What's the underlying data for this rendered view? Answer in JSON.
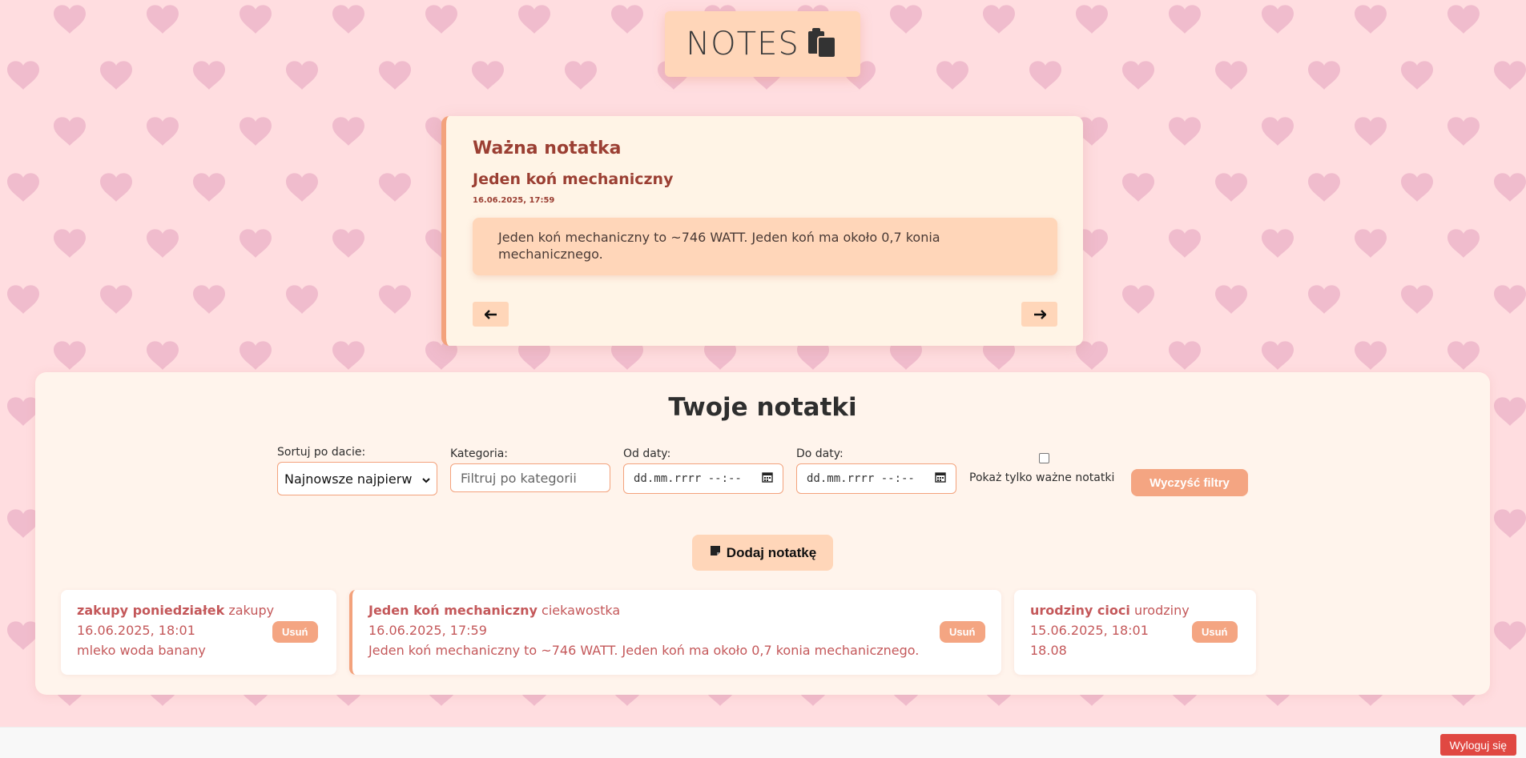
{
  "header": {
    "title": "NOTES",
    "icon": "clipboard-icon"
  },
  "important": {
    "heading": "Ważna notatka",
    "title": "Jeden koń mechaniczny",
    "date": "16.06.2025, 17:59",
    "body": "Jeden koń mechaniczny to ~746 WATT. Jeden koń ma około 0,7 konia mechanicznego.",
    "prev_label": "🡐",
    "next_label": "🡒"
  },
  "panel": {
    "title": "Twoje notatki",
    "sort_label": "Sortuj po dacie:",
    "sort_value": "Najnowsze najpierw",
    "category_label": "Kategoria:",
    "category_placeholder": "Filtruj po kategorii",
    "from_label": "Od daty:",
    "from_placeholder": "dd.mm.rrrr --:--",
    "to_label": "Do daty:",
    "to_placeholder": "dd.mm.rrrr --:--",
    "important_only_label": "Pokaż tylko ważne notatki",
    "clear_label": "Wyczyść filtry",
    "add_label": "Dodaj notatkę"
  },
  "notes": [
    {
      "title": "zakupy poniedziałek",
      "category": "zakupy",
      "date": "16.06.2025, 18:01",
      "body": "mleko woda banany",
      "delete_label": "Usuń"
    },
    {
      "title": "Jeden koń mechaniczny",
      "category": "ciekawostka",
      "date": "16.06.2025, 17:59",
      "body": "Jeden koń mechaniczny to ~746 WATT. Jeden koń ma około 0,7 konia mechanicznego.",
      "delete_label": "Usuń"
    },
    {
      "title": "urodziny cioci",
      "category": "urodziny",
      "date": "15.06.2025, 18:01",
      "body": "18.08",
      "delete_label": "Usuń"
    }
  ],
  "footer": {
    "logout_label": "Wyloguj się"
  },
  "colors": {
    "background": "#ffdde0",
    "heart": "#f0bccd",
    "accent": "#f4a582",
    "peach": "#ffd6b9",
    "note_text": "#c4585a",
    "logout": "#e04842"
  }
}
